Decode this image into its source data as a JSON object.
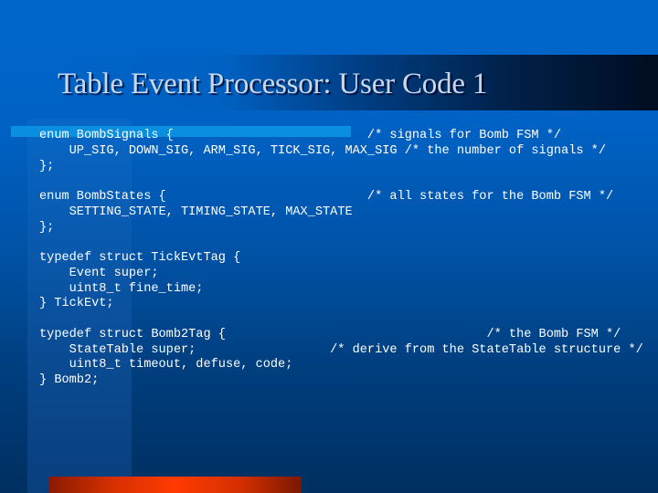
{
  "slide": {
    "title": "Table Event Processor: User Code 1",
    "colors": {
      "background_top": "#0066cc",
      "background_bottom": "#002f61",
      "title_text": "#c8d8ec",
      "accent_bar": "#0a8ee0",
      "code_text": "#ffffff",
      "red_bar_center": "#ff3a00"
    },
    "code_lines": [
      "enum BombSignals {                          /* signals for Bomb FSM */",
      "    UP_SIG, DOWN_SIG, ARM_SIG, TICK_SIG, MAX_SIG /* the number of signals */",
      "};",
      "",
      "enum BombStates {                           /* all states for the Bomb FSM */",
      "    SETTING_STATE, TIMING_STATE, MAX_STATE",
      "};",
      "",
      "typedef struct TickEvtTag {",
      "    Event super;",
      "    uint8_t fine_time;",
      "} TickEvt;",
      "",
      "typedef struct Bomb2Tag {                                   /* the Bomb FSM */",
      "    StateTable super;                  /* derive from the StateTable structure */",
      "    uint8_t timeout, defuse, code;",
      "} Bomb2;"
    ]
  }
}
